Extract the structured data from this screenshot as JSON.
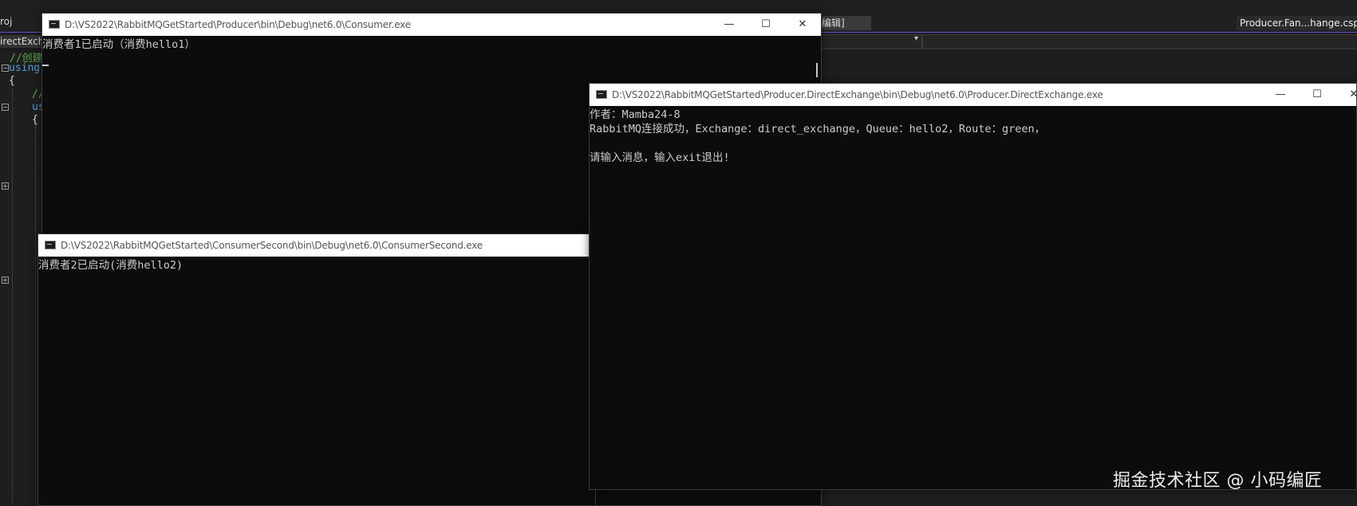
{
  "vs": {
    "tab_left": "roj",
    "tab_mid": "编辑]",
    "tab_right": "Producer.Fan...hange.cspro",
    "nav_left": "irectExch",
    "dropdown_arrow": "▾",
    "code_comment": "//创建",
    "code_using": "using",
    "code_brace": "{",
    "code_comment2": "//",
    "code_using2": "us",
    "code_brace2": "{",
    "fold_minus": "−",
    "fold_plus": "+"
  },
  "windows": {
    "consumer": {
      "title": "D:\\VS2022\\RabbitMQGetStarted\\Producer\\bin\\Debug\\net6.0\\Consumer.exe",
      "lines": [
        "消费者1已启动（消费hello1）"
      ]
    },
    "consumer_second": {
      "title": "D:\\VS2022\\RabbitMQGetStarted\\ConsumerSecond\\bin\\Debug\\net6.0\\ConsumerSecond.exe",
      "lines": [
        "消费者2已启动(消费hello2)"
      ]
    },
    "producer": {
      "title": "D:\\VS2022\\RabbitMQGetStarted\\Producer.DirectExchange\\bin\\Debug\\net6.0\\Producer.DirectExchange.exe",
      "lines": [
        "作者：Mamba24-8",
        "RabbitMQ连接成功，Exchange：direct_exchange，Queue：hello2，Route：green，",
        "",
        "请输入消息，输入exit退出!"
      ]
    },
    "controls": {
      "minimize": "—",
      "maximize": "☐",
      "close": "✕"
    }
  },
  "watermark": "掘金技术社区 @ 小码编匠",
  "colors": {
    "console_bg": "#0c0c0c",
    "console_text": "#cccccc",
    "vs_bg": "#1e1e1e",
    "vs_accent": "#6a4ad0"
  }
}
